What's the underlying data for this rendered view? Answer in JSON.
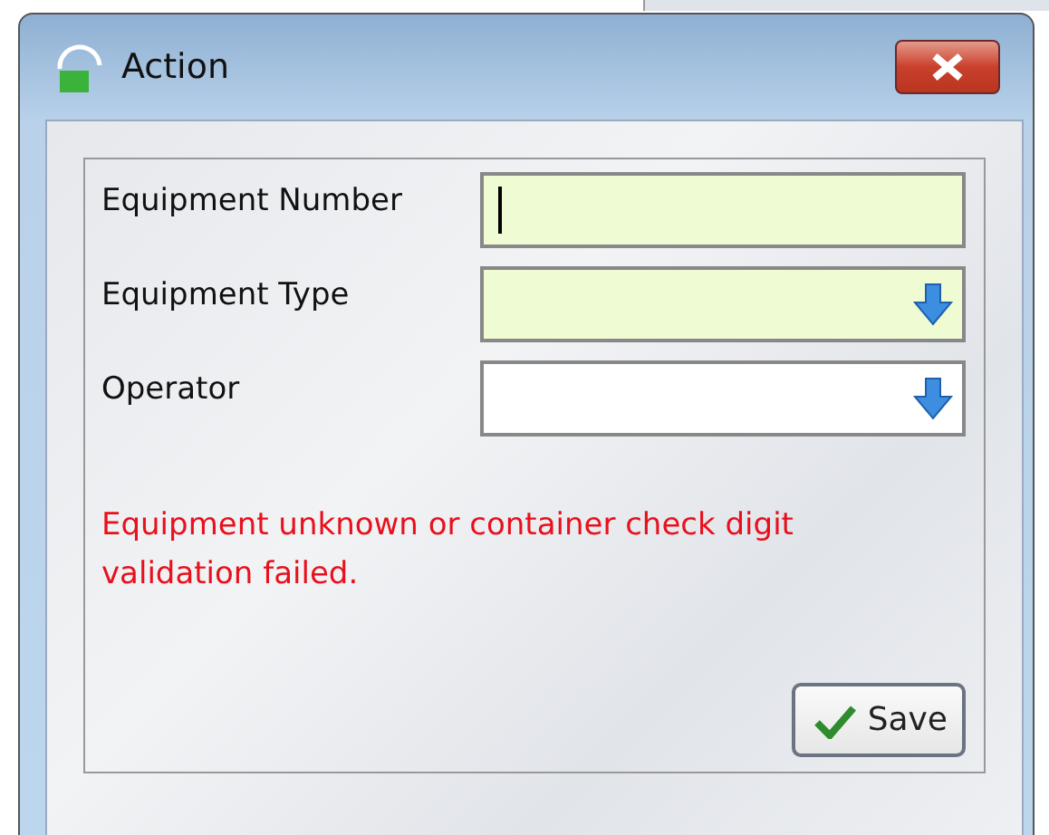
{
  "window": {
    "title": "Action"
  },
  "fields": [
    {
      "label": "Equipment Number",
      "kind": "text",
      "required": true,
      "focused": true
    },
    {
      "label": "Equipment Type",
      "kind": "dropdown",
      "required": true,
      "focused": false
    },
    {
      "label": "Operator",
      "kind": "dropdown",
      "required": false,
      "focused": false
    }
  ],
  "error": "Equipment unknown or container check digit validation failed.",
  "buttons": [
    {
      "label": "Save"
    }
  ]
}
